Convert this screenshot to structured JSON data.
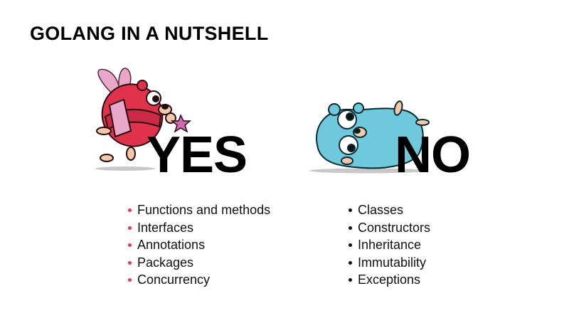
{
  "slide": {
    "title": "GOLANG IN A NUTSHELL"
  },
  "yes": {
    "label": "YES",
    "bullet_color": "#e03a4e",
    "items": [
      "Functions and methods",
      "Interfaces",
      "Annotations",
      "Packages",
      "Concurrency"
    ]
  },
  "no": {
    "label": "NO",
    "bullet_color": "#111111",
    "items": [
      "Classes",
      "Constructors",
      "Inheritance",
      "Immutability",
      "Exceptions"
    ]
  },
  "colors": {
    "red_gopher": "#e0324a",
    "blue_gopher": "#6ec9dc"
  }
}
